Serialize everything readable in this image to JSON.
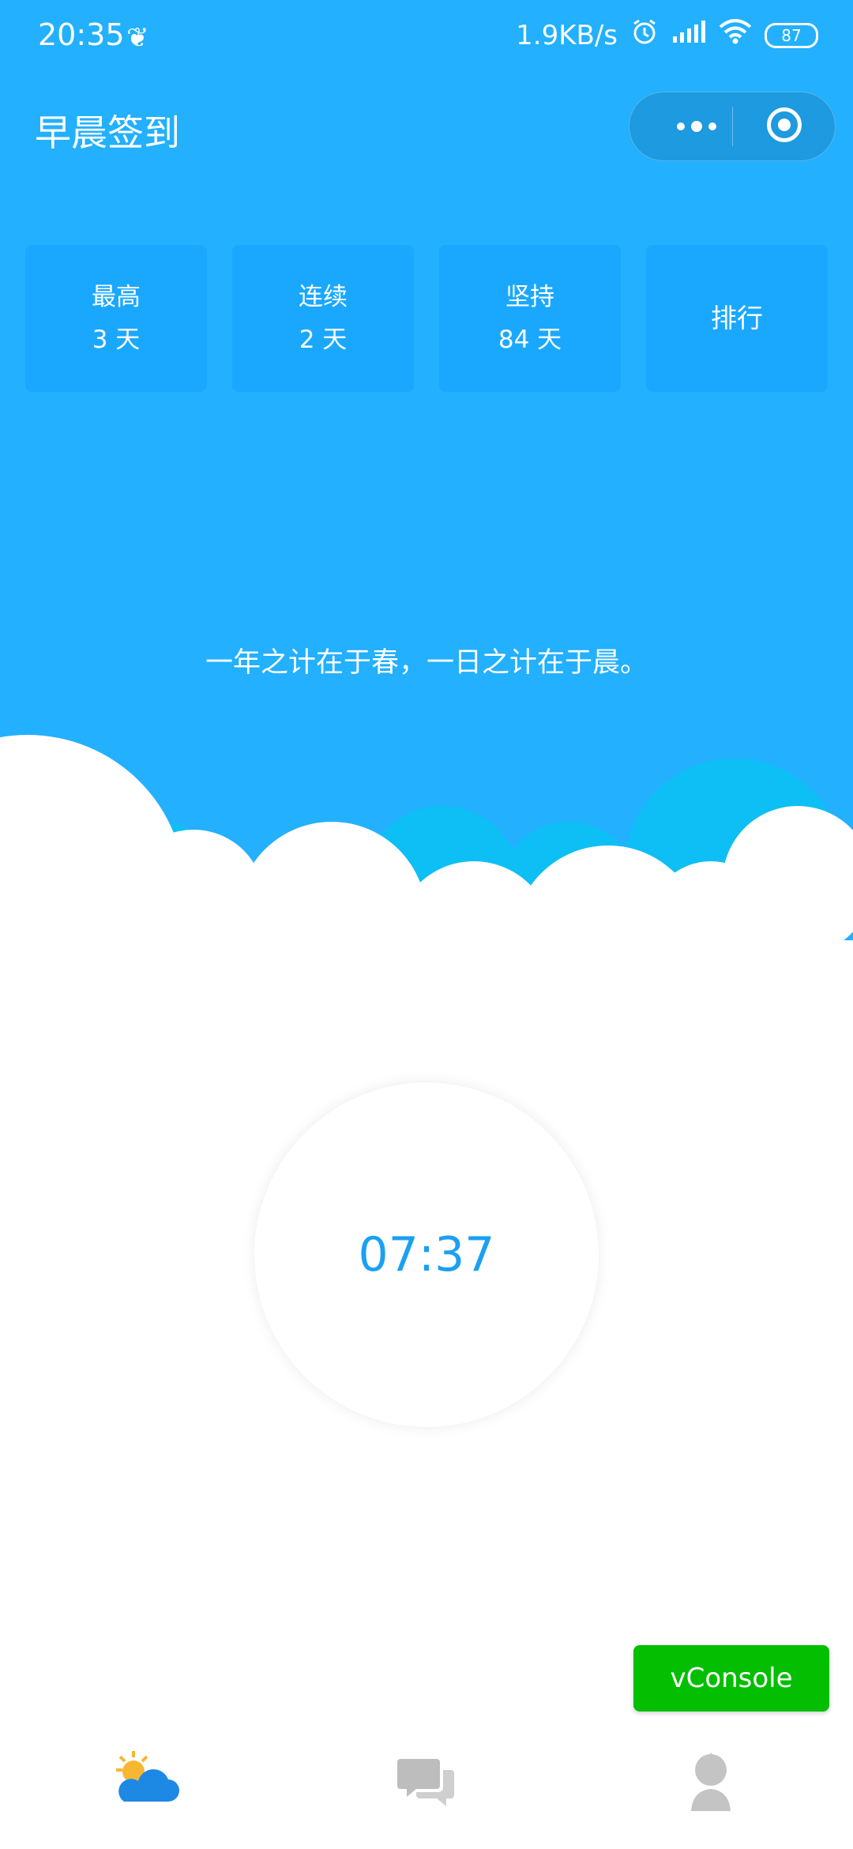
{
  "status_bar": {
    "time": "20:35",
    "network_speed": "1.9KB/s",
    "battery": "87",
    "icons": [
      "leaf-icon",
      "alarm-icon",
      "signal-icon",
      "wifi-icon",
      "battery-icon"
    ]
  },
  "nav": {
    "title": "早晨签到",
    "menu_icon": "more-dots-icon",
    "close_icon": "target-icon"
  },
  "stats": [
    {
      "label": "最高",
      "value": "3 天"
    },
    {
      "label": "连续",
      "value": "2 天"
    },
    {
      "label": "坚持",
      "value": "84 天"
    },
    {
      "label": "排行"
    }
  ],
  "quote": "一年之计在于春，一日之计在于晨。",
  "clock": {
    "time": "07:37"
  },
  "vconsole": {
    "label": "vConsole"
  },
  "tabbar": {
    "items": [
      {
        "icon": "weather-icon"
      },
      {
        "icon": "chat-icon"
      },
      {
        "icon": "profile-icon"
      }
    ]
  },
  "colors": {
    "sky": "#22b0ff",
    "card": "#1aa8ff",
    "accent_text": "#1ba0f2",
    "vconsole": "#04be02"
  }
}
